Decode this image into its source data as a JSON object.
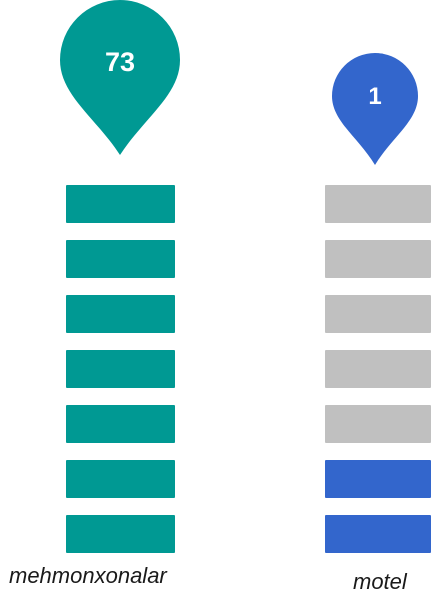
{
  "colors": {
    "teal": "#009993",
    "blue": "#3366cc",
    "gray": "#c0c0c0"
  },
  "columns": [
    {
      "label": "mehmonxonalar",
      "count": "73",
      "pin_color": "#009993",
      "pin_icon": "map-pin-icon",
      "bars_total": 7,
      "bars_filled": 7,
      "filled_color": "#009993",
      "empty_color": "#c0c0c0"
    },
    {
      "label": "motel",
      "count": "1",
      "pin_color": "#3366cc",
      "pin_icon": "map-pin-icon",
      "bars_total": 7,
      "bars_filled": 2,
      "filled_color": "#3366cc",
      "empty_color": "#c0c0c0"
    }
  ]
}
